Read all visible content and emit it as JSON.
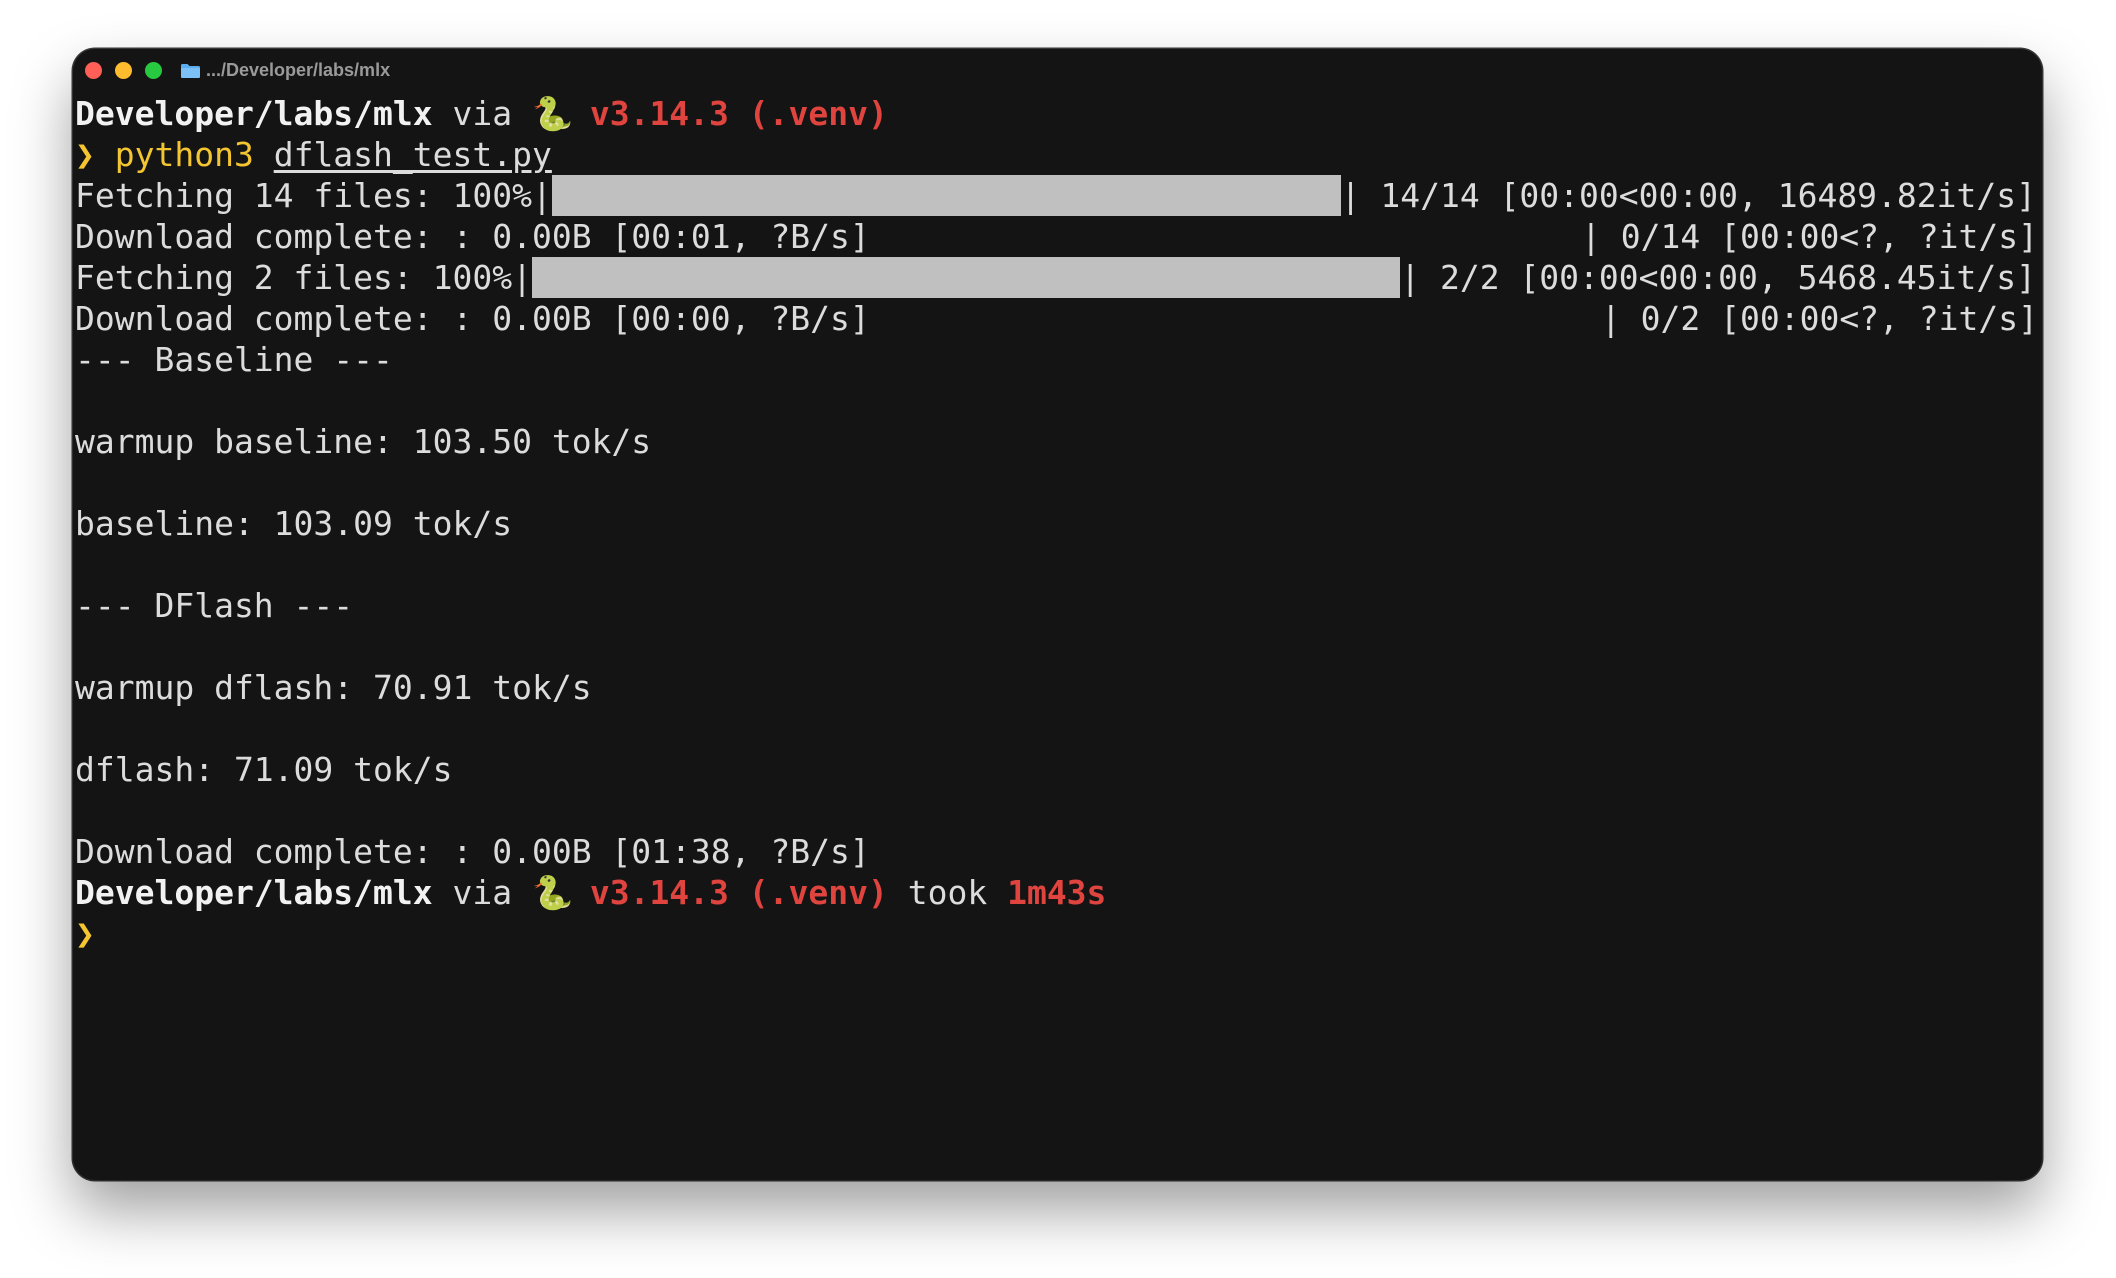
{
  "window": {
    "title": ".../Developer/labs/mlx"
  },
  "prompt1": {
    "dir": "Developer/labs/mlx",
    "via": " via ",
    "snake": "🐍",
    "version": " v3.14.3 (.venv)"
  },
  "command": {
    "symbol": "❯",
    "program": "python3",
    "file": "dflash_test.py"
  },
  "progress1": {
    "label": "Fetching 14 files: 100%|",
    "percent": 100,
    "stats": "| 14/14 [00:00<00:00, 16489.82it/s]"
  },
  "download1": {
    "text": "Download complete: : 0.00B [00:01, ?B/s]",
    "right": "| 0/14 [00:00<?, ?it/s]"
  },
  "progress2": {
    "label": "Fetching 2 files: 100%|",
    "percent": 100,
    "stats": "| 2/2 [00:00<00:00, 5468.45it/s]"
  },
  "download2": {
    "text": "Download complete: : 0.00B [00:00, ?B/s]",
    "right": "| 0/2 [00:00<?, ?it/s]"
  },
  "output": {
    "baseline_header": "--- Baseline ---",
    "warmup_baseline": "warmup baseline: 103.50 tok/s",
    "baseline": "baseline: 103.09 tok/s",
    "dflash_header": "--- DFlash ---",
    "warmup_dflash": "warmup dflash: 70.91 tok/s",
    "dflash": "dflash: 71.09 tok/s",
    "download_final": "Download complete: : 0.00B [01:38, ?B/s]"
  },
  "prompt2": {
    "dir": "Developer/labs/mlx",
    "via": " via ",
    "snake": "🐍",
    "version": " v3.14.3 (.venv)",
    "took": " took ",
    "duration": "1m43s"
  },
  "prompt3": {
    "symbol": "❯"
  },
  "colors": {
    "background": "#141414",
    "text": "#dcdcdc",
    "accent_red": "#e0443f",
    "accent_yellow": "#f3c530",
    "progress_bar": "#c0c0c0"
  }
}
